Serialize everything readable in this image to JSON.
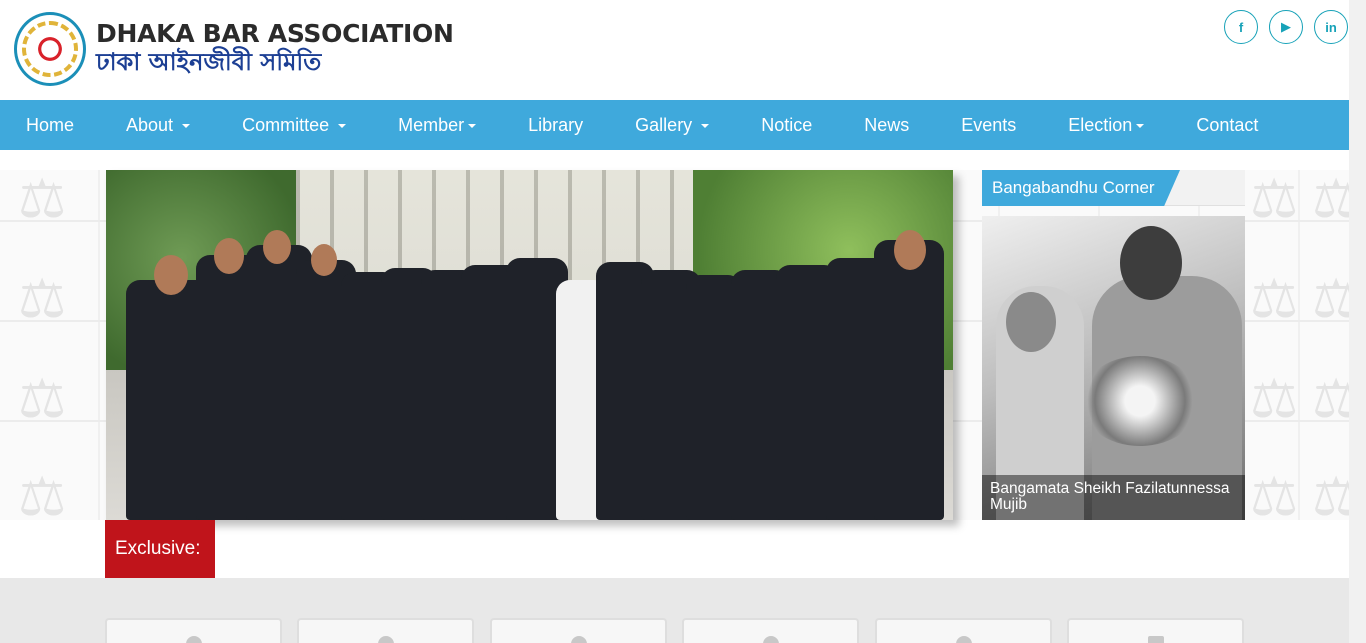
{
  "header": {
    "title_en": "DHAKA BAR ASSOCIATION",
    "title_bn": "ঢাকা আইনজীবী সমিতি",
    "social": [
      {
        "icon": "facebook-icon",
        "glyph": "f"
      },
      {
        "icon": "youtube-icon",
        "glyph": "▶"
      },
      {
        "icon": "linkedin-icon",
        "glyph": "in"
      }
    ]
  },
  "nav": {
    "items": [
      {
        "label": "Home"
      },
      {
        "label": "About"
      },
      {
        "label": "Committee"
      },
      {
        "label": "Member"
      },
      {
        "label": "Library"
      },
      {
        "label": "Gallery"
      },
      {
        "label": "Notice"
      },
      {
        "label": "News"
      },
      {
        "label": "Events"
      },
      {
        "label": "Election"
      },
      {
        "label": "Contact"
      }
    ]
  },
  "sidebar": {
    "heading": "Bangabandhu Corner",
    "caption": "Bangamata Sheikh Fazilatunnessa Mujib"
  },
  "exclusive": {
    "label": "Exclusive:"
  },
  "colors": {
    "nav_bg": "#3fa9dc",
    "exclusive_bg": "#c0141b",
    "social_border": "#17a2b8"
  }
}
